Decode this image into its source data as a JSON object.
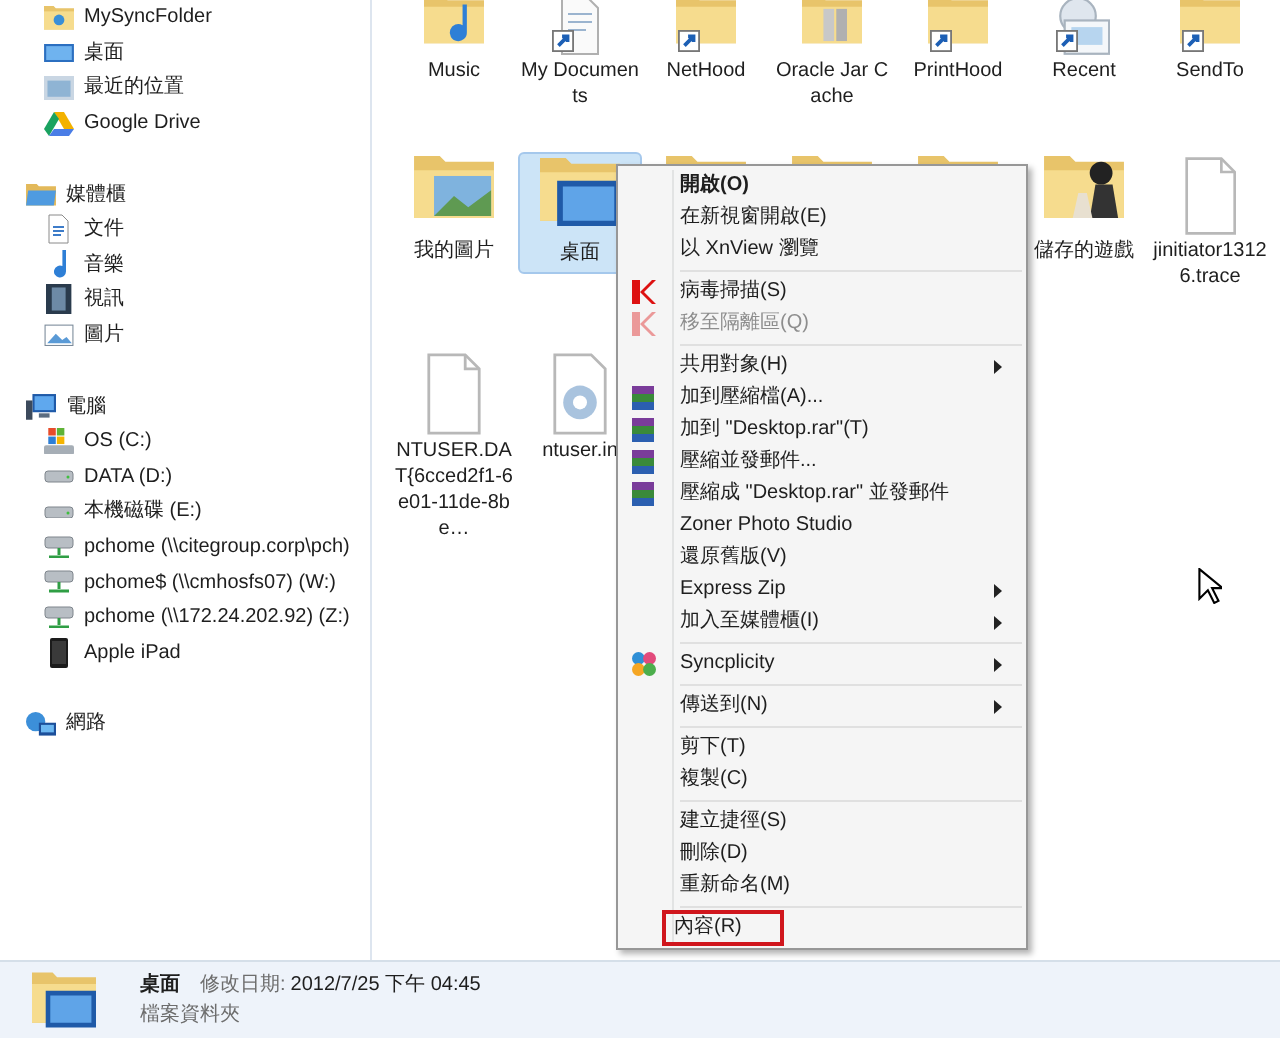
{
  "sidebar": {
    "groups": [
      {
        "items": [
          {
            "label": "MySyncFolder",
            "kind": "syncfolder"
          },
          {
            "label": "桌面",
            "kind": "desktop"
          },
          {
            "label": "最近的位置",
            "kind": "recent"
          },
          {
            "label": "Google Drive",
            "kind": "drive"
          }
        ]
      },
      {
        "label": "媒體櫃",
        "kind": "library",
        "items": [
          {
            "label": "文件",
            "kind": "document"
          },
          {
            "label": "音樂",
            "kind": "music"
          },
          {
            "label": "視訊",
            "kind": "video"
          },
          {
            "label": "圖片",
            "kind": "picture"
          }
        ]
      },
      {
        "label": "電腦",
        "kind": "computer",
        "items": [
          {
            "label": "OS (C:)",
            "kind": "systemdrive"
          },
          {
            "label": "DATA (D:)",
            "kind": "disk"
          },
          {
            "label": "本機磁碟 (E:)",
            "kind": "disk"
          },
          {
            "label": "pchome (\\\\citegroup.corp\\pch)",
            "kind": "netdrive"
          },
          {
            "label": "pchome$ (\\\\cmhosfs07) (W:)",
            "kind": "netdrive"
          },
          {
            "label": "pchome (\\\\172.24.202.92) (Z:)",
            "kind": "netdrive"
          },
          {
            "label": "Apple iPad",
            "kind": "tablet"
          }
        ]
      },
      {
        "label": "網路",
        "kind": "network"
      }
    ]
  },
  "file_rows": [
    [
      {
        "label": "Music",
        "kind": "musicfolder",
        "shortcut": false,
        "selected": false
      },
      {
        "label": "My Documents",
        "kind": "document",
        "shortcut": true,
        "selected": false
      },
      {
        "label": "NetHood",
        "kind": "folder",
        "shortcut": true,
        "selected": false
      },
      {
        "label": "Oracle Jar Cache",
        "kind": "jarfolder",
        "shortcut": false,
        "selected": false
      },
      {
        "label": "PrintHood",
        "kind": "folder",
        "shortcut": true,
        "selected": false
      },
      {
        "label": "Recent",
        "kind": "recent",
        "shortcut": true,
        "selected": false
      },
      {
        "label": "SendTo",
        "kind": "folder",
        "shortcut": true,
        "selected": false
      }
    ],
    [
      {
        "label": "我的圖片",
        "kind": "picturefolder",
        "shortcut": false,
        "selected": false
      },
      {
        "label": "桌面",
        "kind": "desktopfolder",
        "shortcut": false,
        "selected": true
      },
      {
        "kind": "folder",
        "shortcut": false,
        "selected": false
      },
      {
        "kind": "folder",
        "shortcut": false,
        "selected": false
      },
      {
        "kind": "folder",
        "shortcut": false,
        "selected": false
      },
      {
        "label": "儲存的遊戲",
        "kind": "gamesfolder",
        "shortcut": false,
        "selected": false
      },
      {
        "label": "jinitiator13126.trace",
        "kind": "file",
        "shortcut": false,
        "selected": false
      }
    ],
    [
      {
        "label": "NTUSER.DAT{6cced2f1-6e01-11de-8be…",
        "kind": "file",
        "shortcut": false,
        "selected": false
      },
      {
        "label": "ntuser.in",
        "kind": "settings",
        "shortcut": false,
        "selected": false
      }
    ]
  ],
  "context_menu": {
    "sections": [
      [
        {
          "label": "開啟(O)",
          "bold": true
        },
        {
          "label": "在新視窗開啟(E)"
        },
        {
          "label": "以 XnView 瀏覽"
        }
      ],
      [
        {
          "label": "病毒掃描(S)",
          "kind": "antivirus"
        },
        {
          "label": "移至隔離區(Q)",
          "kind": "antivirus",
          "disabled": true
        }
      ],
      [
        {
          "label": "共用對象(H)",
          "submenu": true
        },
        {
          "label": "加到壓縮檔(A)...",
          "kind": "archive"
        },
        {
          "label": "加到 \"Desktop.rar\"(T)",
          "kind": "archive"
        },
        {
          "label": "壓縮並發郵件...",
          "kind": "archive"
        },
        {
          "label": "壓縮成 \"Desktop.rar\" 並發郵件",
          "kind": "archive"
        },
        {
          "label": "Zoner Photo Studio"
        },
        {
          "label": "還原舊版(V)"
        },
        {
          "label": "Express Zip",
          "submenu": true
        },
        {
          "label": "加入至媒體櫃(I)",
          "submenu": true
        }
      ],
      [
        {
          "label": "Syncplicity",
          "kind": "sync",
          "submenu": true
        }
      ],
      [
        {
          "label": "傳送到(N)",
          "submenu": true
        }
      ],
      [
        {
          "label": "剪下(T)"
        },
        {
          "label": "複製(C)"
        }
      ],
      [
        {
          "label": "建立捷徑(S)"
        },
        {
          "label": "刪除(D)"
        },
        {
          "label": "重新命名(M)"
        }
      ],
      [
        {
          "label": "內容(R)",
          "highlighted": true
        }
      ]
    ]
  },
  "status_bar": {
    "name": "桌面",
    "modified_label": "修改日期:",
    "modified_value": "2012/7/25 下午 04:45",
    "type": "檔案資料夾"
  }
}
